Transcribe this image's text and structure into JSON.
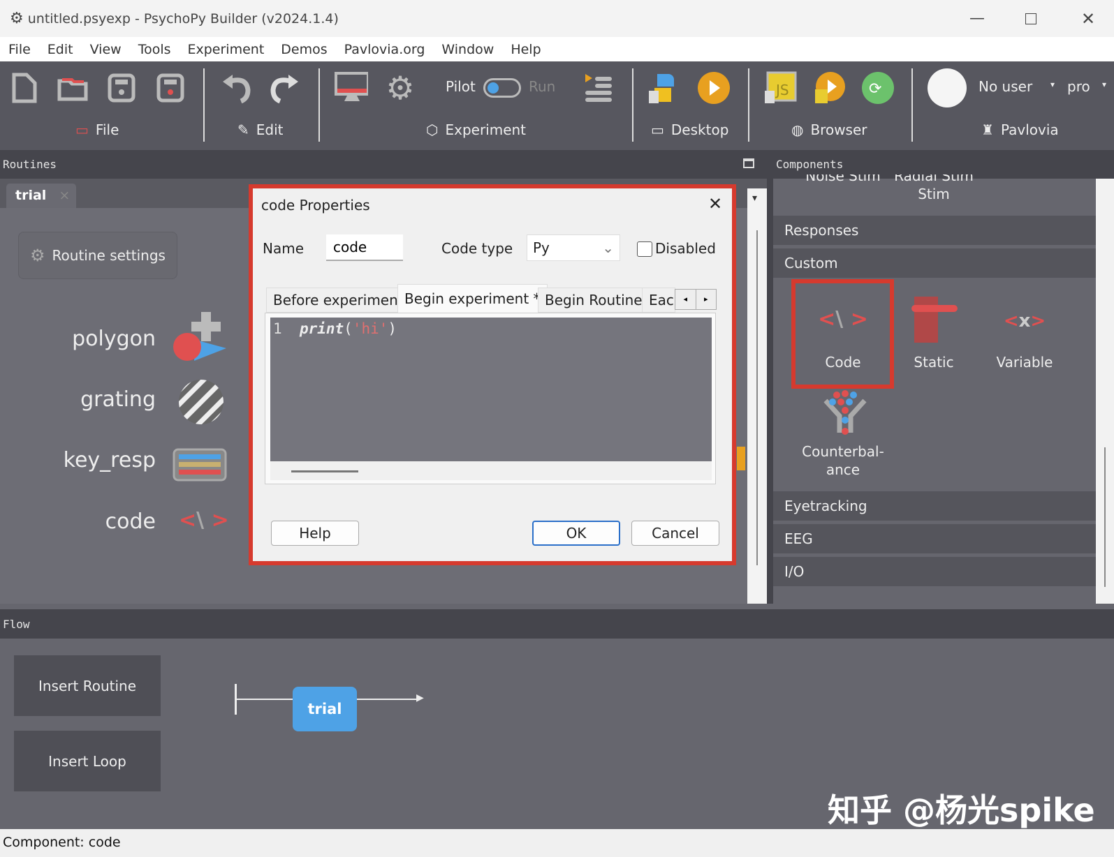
{
  "window": {
    "title": "untitled.psyexp - PsychoPy Builder (v2024.1.4)"
  },
  "menu": [
    "File",
    "Edit",
    "View",
    "Tools",
    "Experiment",
    "Demos",
    "Pavlovia.org",
    "Window",
    "Help"
  ],
  "toolbar": {
    "groups": {
      "file": "File",
      "edit": "Edit",
      "experiment": "Experiment",
      "desktop": "Desktop",
      "browser": "Browser",
      "pavlovia": "Pavlovia"
    },
    "pilot": "Pilot",
    "run": "Run",
    "user": "No user",
    "project": "pro"
  },
  "routines": {
    "header": "Routines",
    "tab": "trial",
    "settings": "Routine settings",
    "components": [
      {
        "name": "polygon"
      },
      {
        "name": "grating"
      },
      {
        "name": "key_resp"
      },
      {
        "name": "code"
      }
    ]
  },
  "components_panel": {
    "header": "Components",
    "partial": [
      "Noise Stim",
      "Radial Stim"
    ],
    "categories": {
      "responses": "Responses",
      "custom": "Custom",
      "eyetracking": "Eyetracking",
      "eeg": "EEG",
      "io": "I/O"
    },
    "custom_items": [
      "Code",
      "Static",
      "Variable",
      "Counterbal-ance"
    ]
  },
  "dialog": {
    "title": "code Properties",
    "name_label": "Name",
    "name_value": "code",
    "code_type_label": "Code type",
    "code_type_value": "Py",
    "disabled_label": "Disabled",
    "disabled": false,
    "tabs": [
      "Before experiment",
      "Begin experiment *",
      "Begin Routine",
      "Eac"
    ],
    "active_tab": 1,
    "code_line_no": "1",
    "code_func": "print",
    "code_open": "(",
    "code_str": "'hi'",
    "code_close": ")",
    "help": "Help",
    "ok": "OK",
    "cancel": "Cancel"
  },
  "flow": {
    "header": "Flow",
    "insert_routine": "Insert Routine",
    "insert_loop": "Insert Loop",
    "routine": "trial"
  },
  "watermark": "知乎 @杨光spike",
  "status": "Component: code",
  "colors": {
    "accent_red": "#d63a2e",
    "blue": "#4ea2e6",
    "orange": "#e8a020"
  }
}
